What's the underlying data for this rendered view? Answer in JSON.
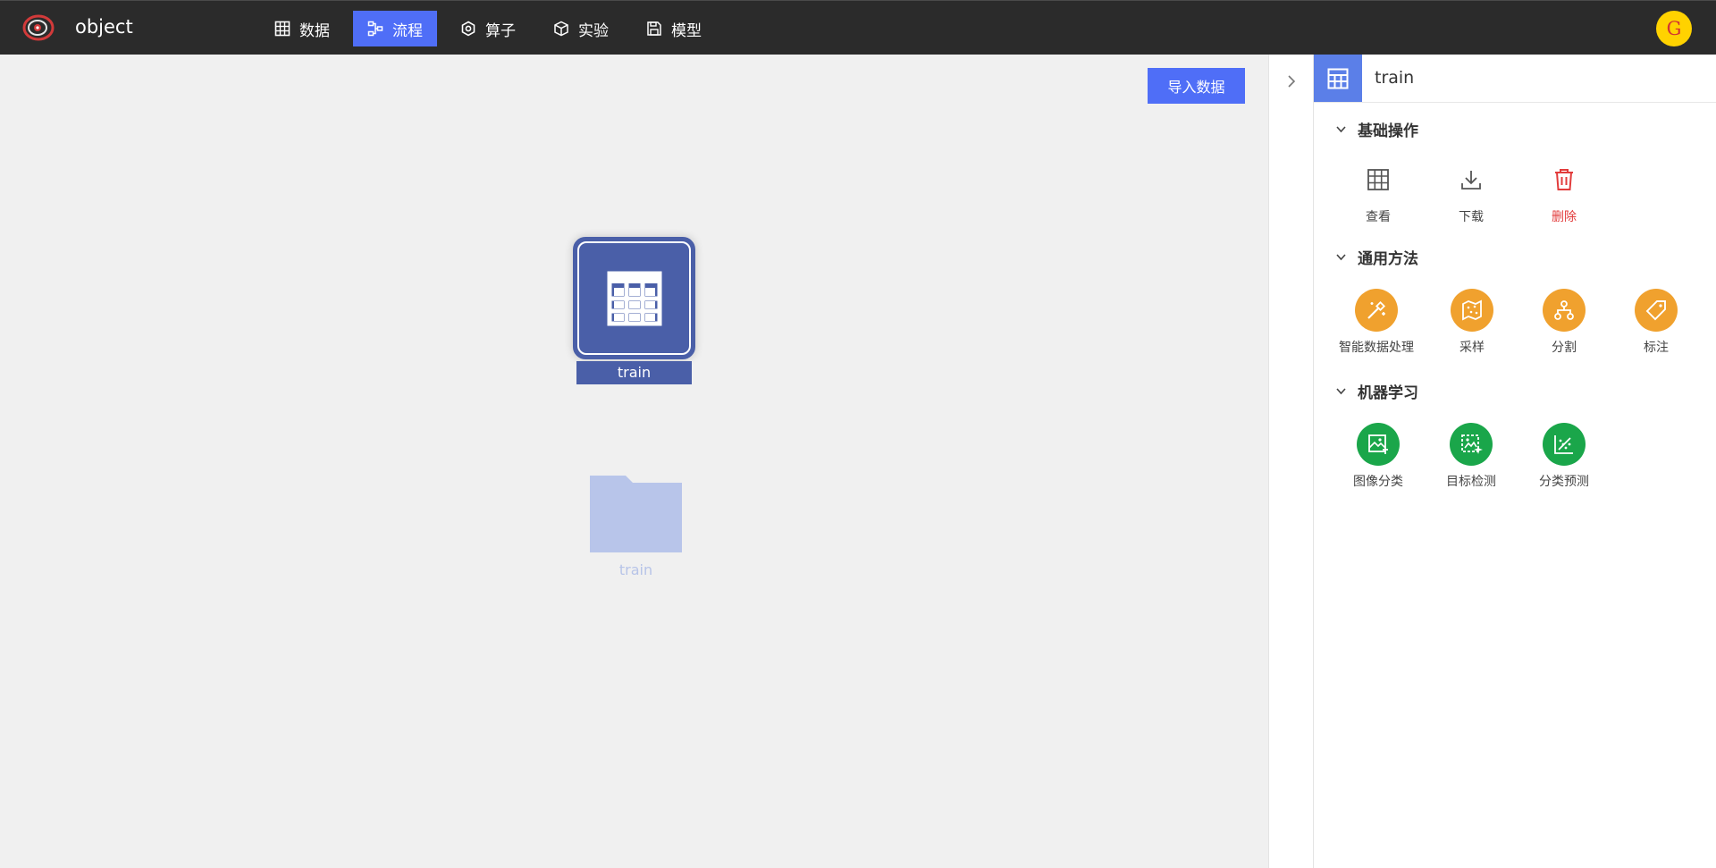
{
  "project": {
    "name": "object"
  },
  "nav": {
    "items": [
      {
        "label": "数据",
        "icon": "table-icon"
      },
      {
        "label": "流程",
        "icon": "flow-icon",
        "active": true
      },
      {
        "label": "算子",
        "icon": "hexagon-icon"
      },
      {
        "label": "实验",
        "icon": "cube-icon"
      },
      {
        "label": "模型",
        "icon": "save-icon"
      }
    ]
  },
  "user": {
    "avatar_initial": "G",
    "avatar_color": "#ffd200"
  },
  "canvas": {
    "import_button_label": "导入数据",
    "selected_node": {
      "label": "train",
      "icon": "table-icon"
    },
    "folder_node": {
      "label": "train",
      "icon": "folder-icon"
    }
  },
  "panel": {
    "title": "train",
    "sections": [
      {
        "title": "基础操作",
        "items": [
          {
            "label": "查看",
            "icon": "table-icon"
          },
          {
            "label": "下载",
            "icon": "download-icon"
          },
          {
            "label": "删除",
            "icon": "trash-icon"
          }
        ]
      },
      {
        "title": "通用方法",
        "items": [
          {
            "label": "智能数据处理",
            "icon": "magic-wand-icon"
          },
          {
            "label": "采样",
            "icon": "sample-map-icon"
          },
          {
            "label": "分割",
            "icon": "split-icon"
          },
          {
            "label": "标注",
            "icon": "tag-icon"
          }
        ]
      },
      {
        "title": "机器学习",
        "items": [
          {
            "label": "图像分类",
            "icon": "image-classify-icon"
          },
          {
            "label": "目标检测",
            "icon": "object-detect-icon"
          },
          {
            "label": "分类预测",
            "icon": "chart-predict-icon"
          }
        ]
      }
    ]
  },
  "colors": {
    "accent": "#4f6ef7",
    "node": "#4a5fa8",
    "orange": "#f0a12e",
    "green": "#1aa64a",
    "danger": "#e23c3c"
  }
}
